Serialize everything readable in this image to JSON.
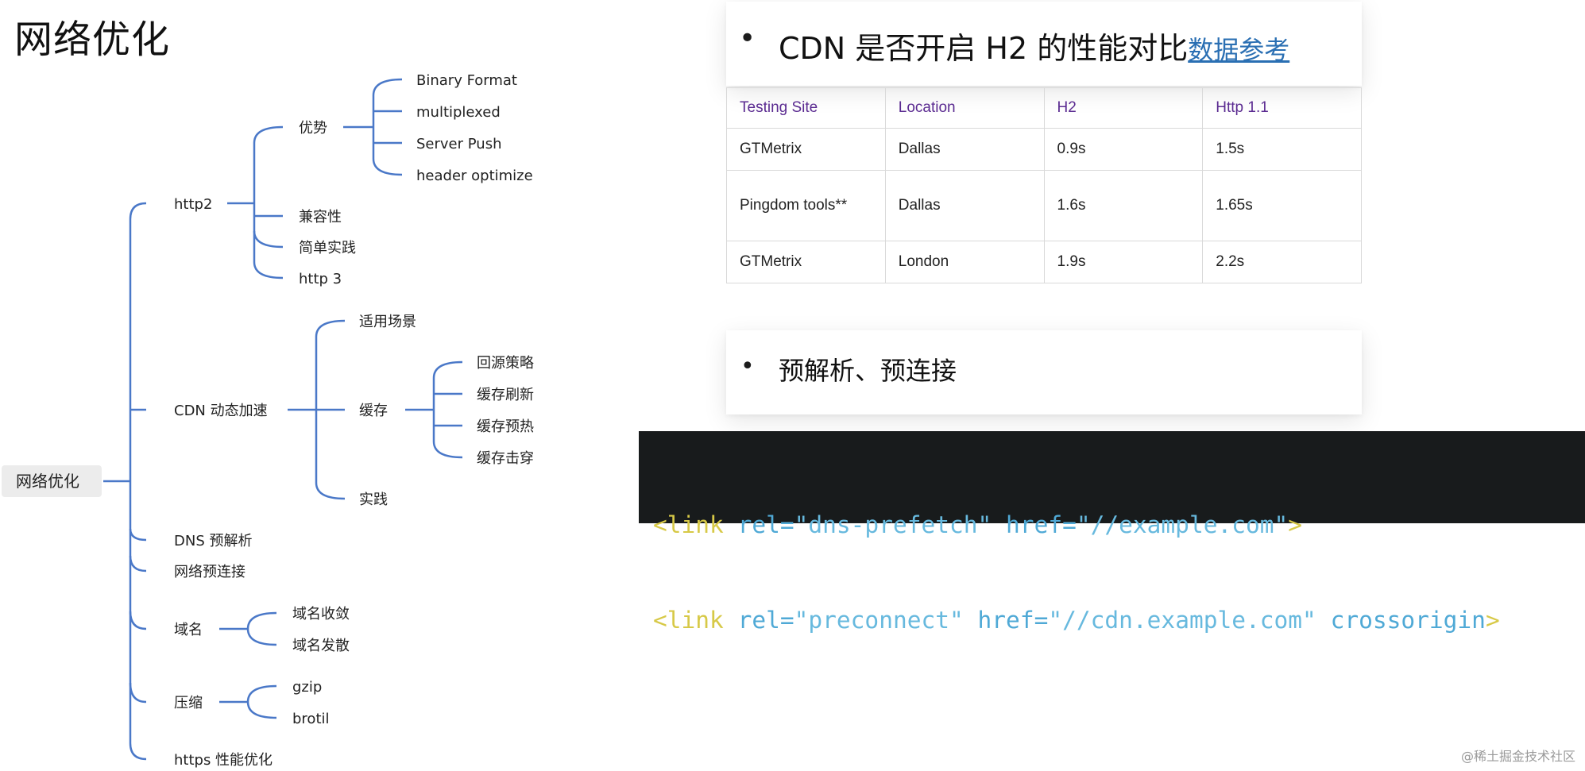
{
  "title": "网络优化",
  "mindmap": {
    "root": "网络优化",
    "branches": {
      "http2": "http2",
      "http2_adv": "优势",
      "adv_1": "Binary Format",
      "adv_2": "multiplexed",
      "adv_3": "Server Push",
      "adv_4": "header optimize",
      "http2_compat": "兼容性",
      "http2_practice": "简单实践",
      "http3": "http 3",
      "cdn": "CDN 动态加速",
      "cdn_scene": "适用场景",
      "cdn_cache": "缓存",
      "cache_1": "回源策略",
      "cache_2": "缓存刷新",
      "cache_3": "缓存预热",
      "cache_4": "缓存击穿",
      "cdn_practice": "实践",
      "dns": "DNS 预解析",
      "preconnect": "网络预连接",
      "domain": "域名",
      "domain_1": "域名收敛",
      "domain_2": "域名发散",
      "compress": "压缩",
      "compress_1": "gzip",
      "compress_2": "brotil",
      "https": "https 性能优化"
    }
  },
  "h2_card": {
    "bullet": "•",
    "heading": "CDN 是否开启 H2 的性能对比",
    "link": "数据参考"
  },
  "table": {
    "headers": [
      "Testing Site",
      "Location",
      "H2",
      "Http 1.1"
    ],
    "rows": [
      [
        "GTMetrix",
        "Dallas",
        "0.9s",
        "1.5s"
      ],
      [
        "Pingdom tools**",
        "Dallas",
        "1.6s",
        "1.65s"
      ],
      [
        "GTMetrix",
        "London",
        "1.9s",
        "2.2s"
      ]
    ]
  },
  "pre_card": {
    "bullet": "•",
    "heading": "预解析、预连接"
  },
  "code": {
    "line1": {
      "tag": "<link",
      "attr1": "rel=",
      "val1": "\"dns-prefetch\"",
      "attr2": "href=",
      "val2": "\"//example.com\"",
      "close": ">"
    },
    "line2": {
      "tag": "<link",
      "attr1": "rel=",
      "val1": "\"preconnect\"",
      "attr2": "href=",
      "val2": "\"//cdn.example.com\"",
      "attr3": "crossorigin",
      "close": ">"
    }
  },
  "footer": "@稀土掘金技术社区",
  "colors": {
    "edge": "#4a78c8",
    "header_text": "#5b2b91",
    "link": "#2a6fb3",
    "code_bg": "#181b1c"
  }
}
